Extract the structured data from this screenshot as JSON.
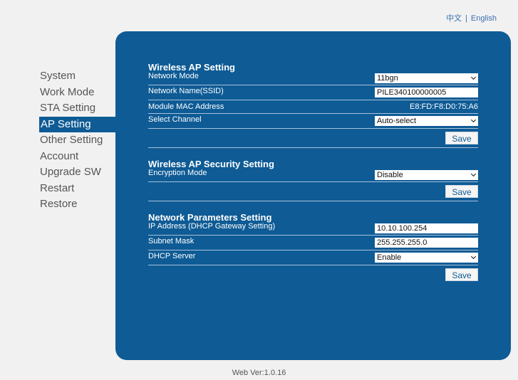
{
  "language": {
    "chinese": "中文",
    "separator": "|",
    "english": "English"
  },
  "sidebar": {
    "items": [
      {
        "label": "System"
      },
      {
        "label": "Work Mode"
      },
      {
        "label": "STA Setting"
      },
      {
        "label": "AP Setting",
        "active": true
      },
      {
        "label": "Other Setting"
      },
      {
        "label": "Account"
      },
      {
        "label": "Upgrade SW"
      },
      {
        "label": "Restart"
      },
      {
        "label": "Restore"
      }
    ]
  },
  "wireless_ap": {
    "title": "Wireless AP Setting",
    "network_mode_label": "Network Mode",
    "network_mode_value": "11bgn",
    "ssid_label": "Network Name(SSID)",
    "ssid_value": "PILE340100000005",
    "mac_label": "Module MAC Address",
    "mac_value": "E8:FD:F8:D0:75:A6",
    "channel_label": "Select Channel",
    "channel_value": "Auto-select",
    "save_label": "Save"
  },
  "security": {
    "title": "Wireless AP Security Setting",
    "encryption_label": "Encryption Mode",
    "encryption_value": "Disable",
    "save_label": "Save"
  },
  "network": {
    "title": "Network Parameters Setting",
    "ip_label": "IP Address (DHCP Gateway Setting)",
    "ip_value": "10.10.100.254",
    "subnet_label": "Subnet Mask",
    "subnet_value": "255.255.255.0",
    "dhcp_label": "DHCP Server",
    "dhcp_value": "Enable",
    "save_label": "Save"
  },
  "footer": {
    "version": "Web Ver:1.0.16"
  },
  "colors": {
    "panel": "#0e5b95",
    "background": "#f1f1f1",
    "link": "#3a6fb0"
  }
}
